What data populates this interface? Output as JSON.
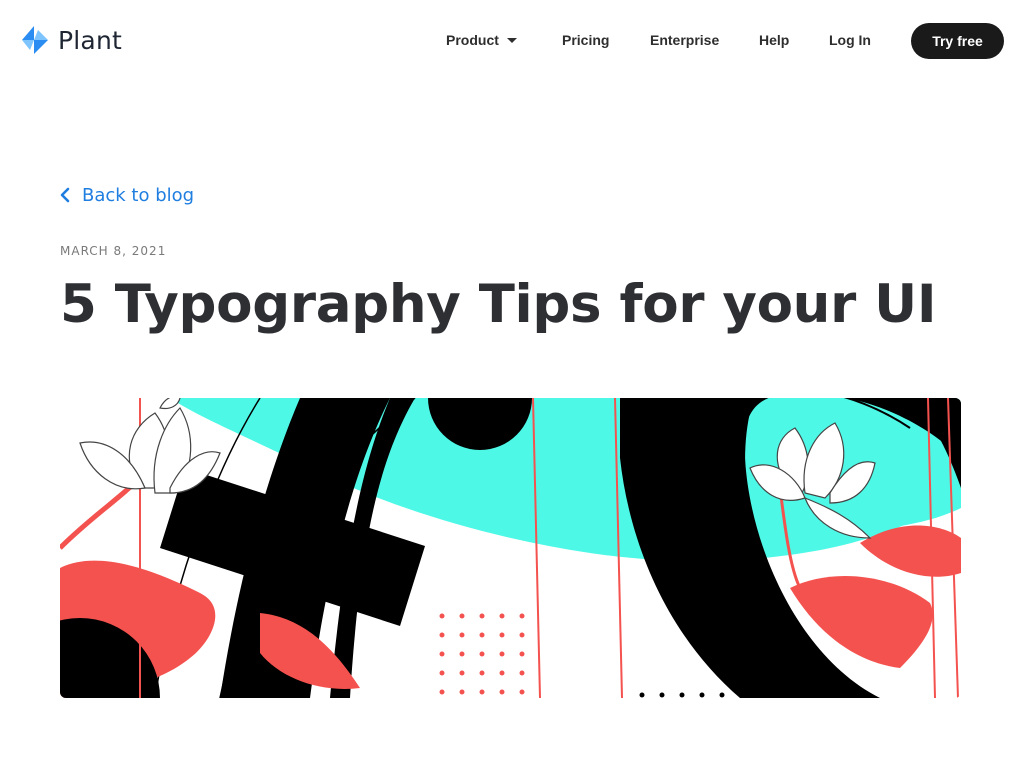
{
  "brand": {
    "name": "Plant",
    "accent_color": "#1f7ee0",
    "logo_icon": "plant-logo-icon"
  },
  "nav": {
    "items": [
      {
        "label": "Product",
        "has_dropdown": true
      },
      {
        "label": "Pricing"
      },
      {
        "label": "Enterprise"
      },
      {
        "label": "Help"
      },
      {
        "label": "Log In"
      }
    ],
    "cta_label": "Try free"
  },
  "post": {
    "back_label": "Back to blog",
    "back_icon": "chevron-left-icon",
    "date": "MARCH 8, 2021",
    "title": "5 Typography Tips for your UI"
  },
  "hero": {
    "colors": {
      "cyan": "#4ef8e6",
      "coral": "#f4524f",
      "black": "#000000"
    }
  }
}
